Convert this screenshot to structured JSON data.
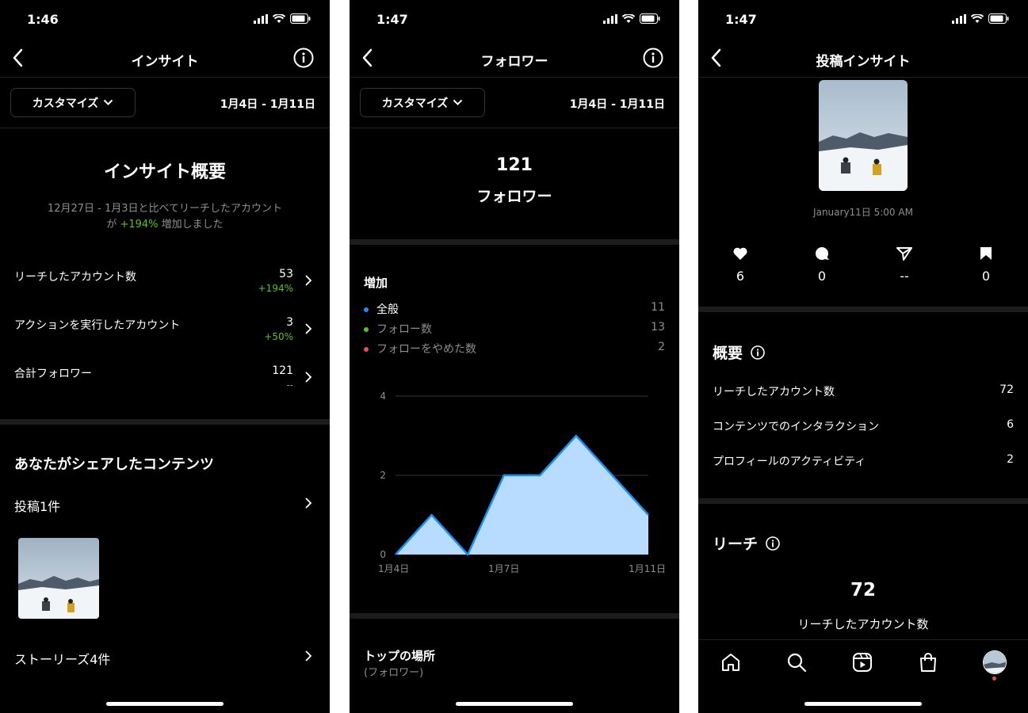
{
  "status": {
    "time1": "1:46",
    "time2": "1:47",
    "time3": "1:47"
  },
  "screen1": {
    "title": "インサイト",
    "customize_label": "カスタマイズ",
    "date_range": "1月4日 - 1月11日",
    "overview_title": "インサイト概要",
    "compare_line1": "12月27日 - 1月3日と比べてリーチしたアカウント",
    "compare_prefix": "が",
    "compare_pct": "+194%",
    "compare_suffix": "増加しました",
    "metrics": [
      {
        "label": "リーチしたアカウント数",
        "value": "53",
        "change": "+194%"
      },
      {
        "label": "アクションを実行したアカウント",
        "value": "3",
        "change": "+50%"
      },
      {
        "label": "合計フォロワー",
        "value": "121",
        "change": "--"
      }
    ],
    "shared_title": "あなたがシェアしたコンテンツ",
    "posts_label": "投稿1件",
    "stories_label": "ストーリーズ4件"
  },
  "screen2": {
    "title": "フォロワー",
    "customize_label": "カスタマイズ",
    "date_range": "1月4日 - 1月11日",
    "followers_count": "121",
    "followers_label": "フォロワー",
    "growth_title": "増加",
    "legend": [
      {
        "label": "全般",
        "value": "11",
        "color": "#1c8ff5"
      },
      {
        "label": "フォロー数",
        "value": "13",
        "color": "#58c322"
      },
      {
        "label": "フォローをやめた数",
        "value": "2",
        "color": "#ed4956"
      }
    ],
    "top_places_title": "トップの場所",
    "top_places_sub": "(フォロワー)"
  },
  "chart_data": {
    "type": "area",
    "x": [
      "1月4日",
      "1月5日",
      "1月6日",
      "1月7日",
      "1月8日",
      "1月9日",
      "1月10日",
      "1月11日"
    ],
    "values": [
      0,
      1,
      0,
      2,
      2,
      3,
      2,
      1
    ],
    "tick_labels_x": [
      "1月4日",
      "1月7日",
      "1月11日"
    ],
    "tick_labels_y": [
      "0",
      "2",
      "4"
    ],
    "ylim": [
      0,
      4
    ],
    "grid": true,
    "fill_color": "#b8dcff",
    "line_color": "#1c8ff5"
  },
  "screen3": {
    "title": "投稿インサイト",
    "post_date": "January11日 5:00 AM",
    "stats": [
      {
        "icon": "heart-icon",
        "value": "6"
      },
      {
        "icon": "comment-icon",
        "value": "0"
      },
      {
        "icon": "share-icon",
        "value": "--"
      },
      {
        "icon": "bookmark-icon",
        "value": "0"
      }
    ],
    "overview_title": "概要",
    "overview_rows": [
      {
        "label": "リーチしたアカウント数",
        "value": "72"
      },
      {
        "label": "コンテンツでのインタラクション",
        "value": "6"
      },
      {
        "label": "プロフィールのアクティビティ",
        "value": "2"
      }
    ],
    "reach_title": "リーチ",
    "reach_value": "72",
    "reach_label": "リーチしたアカウント数"
  }
}
